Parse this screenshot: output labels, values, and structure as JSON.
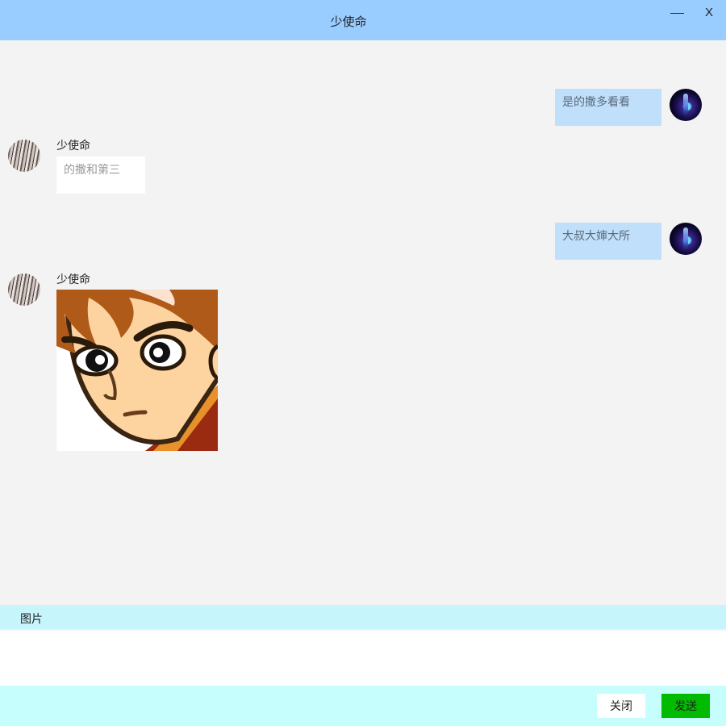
{
  "window": {
    "title": "少使命",
    "minimize_label": "—",
    "close_label": "X"
  },
  "messages": [
    {
      "from": "self",
      "text": "是的撒多看看"
    },
    {
      "from": "other",
      "sender": "少使命",
      "text": "的撒和第三"
    },
    {
      "from": "self",
      "text": "大叔大婶大所"
    },
    {
      "from": "other",
      "sender": "少使命",
      "type": "image"
    }
  ],
  "toolbar": {
    "image_label": "图片"
  },
  "input": {
    "value": "",
    "placeholder": ""
  },
  "footer": {
    "close_label": "关闭",
    "send_label": "发送"
  },
  "colors": {
    "titlebar": "#99ccff",
    "self_bubble": "#c0dffb",
    "other_bubble": "#ffffff",
    "send_button": "#00bb00",
    "toolbar": "#c6f5fc"
  }
}
